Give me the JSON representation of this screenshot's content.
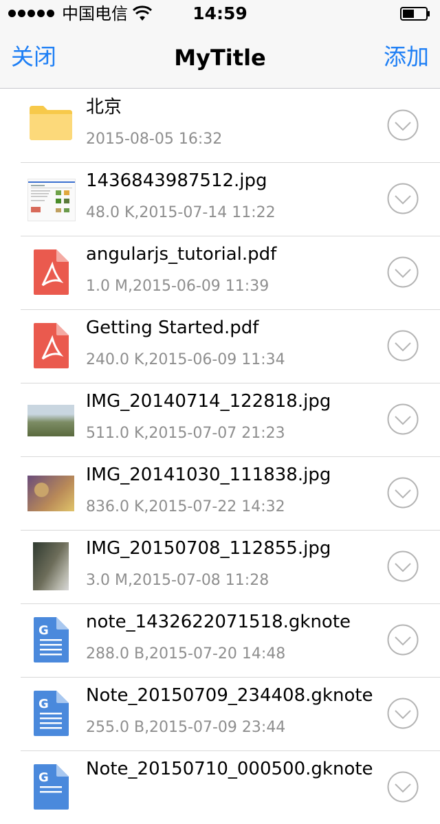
{
  "status": {
    "carrier": "中国电信",
    "time": "14:59"
  },
  "nav": {
    "left": "关闭",
    "title": "MyTitle",
    "right": "添加"
  },
  "files": [
    {
      "name": "北京",
      "meta": "2015-08-05 16:32",
      "icon": "folder-icon"
    },
    {
      "name": "1436843987512.jpg",
      "meta": "48.0 K,2015-07-14 11:22",
      "icon": "image-thumbnail"
    },
    {
      "name": "angularjs_tutorial.pdf",
      "meta": "1.0 M,2015-06-09 11:39",
      "icon": "pdf-icon"
    },
    {
      "name": "Getting Started.pdf",
      "meta": "240.0 K,2015-06-09 11:34",
      "icon": "pdf-icon"
    },
    {
      "name": "IMG_20140714_122818.jpg",
      "meta": "511.0 K,2015-07-07 21:23",
      "icon": "image-thumbnail"
    },
    {
      "name": "IMG_20141030_111838.jpg",
      "meta": "836.0 K,2015-07-22 14:32",
      "icon": "image-thumbnail"
    },
    {
      "name": "IMG_20150708_112855.jpg",
      "meta": "3.0 M,2015-07-08 11:28",
      "icon": "image-thumbnail"
    },
    {
      "name": "note_1432622071518.gknote",
      "meta": "288.0 B,2015-07-20 14:48",
      "icon": "gknote-icon"
    },
    {
      "name": "Note_20150709_234408.gknote",
      "meta": "255.0 B,2015-07-09 23:44",
      "icon": "gknote-icon"
    },
    {
      "name": "Note_20150710_000500.gknote",
      "meta": "",
      "icon": "gknote-icon"
    }
  ],
  "colors": {
    "accent": "#1e7ff5",
    "pdf": "#ea5a4e",
    "gknote": "#4a89dc",
    "folder": "#fcd56a"
  }
}
